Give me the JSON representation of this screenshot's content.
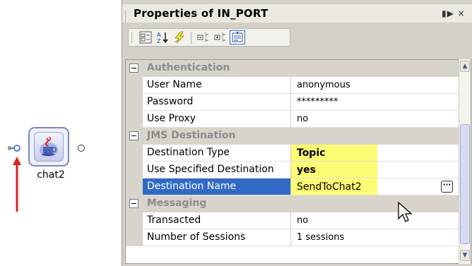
{
  "canvas": {
    "node_label": "chat2",
    "arrow_color": "#e02020"
  },
  "panel": {
    "title": "Properties of IN_PORT",
    "title_buttons": "▮▶ ×",
    "toolbar": {
      "icons": [
        "categorized-icon",
        "sort-alpha-icon",
        "lightning-icon",
        "collapse-icon",
        "expand-icon",
        "property-pages-icon"
      ],
      "sort_label": "A Z"
    }
  },
  "grid": {
    "categories": [
      {
        "name": "Authentication",
        "rows": [
          {
            "name": "User Name",
            "value": "anonymous"
          },
          {
            "name": "Password",
            "value": "*********"
          },
          {
            "name": "Use Proxy",
            "value": "no"
          }
        ]
      },
      {
        "name": "JMS Destination",
        "rows": [
          {
            "name": "Destination Type",
            "value": "Topic"
          },
          {
            "name": "Use Specified Destination",
            "value": "yes"
          },
          {
            "name": "Destination Name",
            "value": "SendToChat2",
            "ellipsis": "···"
          }
        ]
      },
      {
        "name": "Messaging",
        "rows": [
          {
            "name": "Transacted",
            "value": "no"
          },
          {
            "name": "Number of Sessions",
            "value": "1 sessions"
          }
        ]
      }
    ],
    "selection_color": "#316ac5",
    "highlight_color": "#fcfc7a"
  }
}
